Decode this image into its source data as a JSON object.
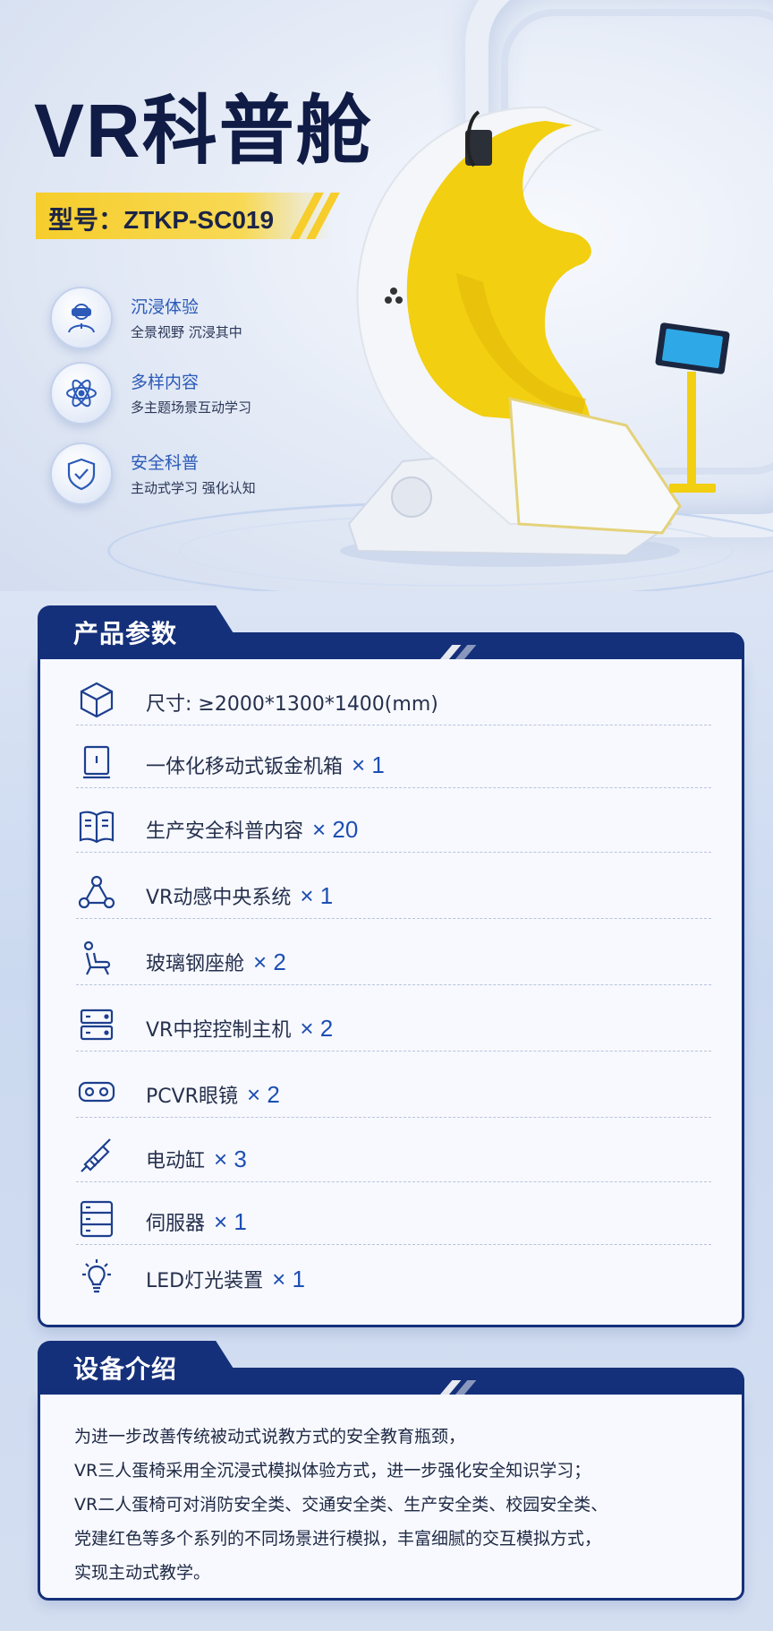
{
  "hero": {
    "title": "VR科普舱",
    "model": "型号：ZTKP-SC019",
    "features": [
      {
        "title": "沉浸体验",
        "subtitle": "全景视野 沉浸其中",
        "icon": "vr-headset-person-icon"
      },
      {
        "title": "多样内容",
        "subtitle": "多主题场景互动学习",
        "icon": "atom-icon"
      },
      {
        "title": "安全科普",
        "subtitle": "主动式学习 强化认知",
        "icon": "shield-check-icon"
      }
    ]
  },
  "specs": {
    "heading": "产品参数",
    "items": [
      {
        "label": "尺寸: ≥2000*1300*1400(mm)",
        "qty": "",
        "icon": "cube-icon"
      },
      {
        "label": "一体化移动式钣金机箱",
        "qty": "× 1",
        "icon": "cabinet-icon"
      },
      {
        "label": "生产安全科普内容",
        "qty": "× 20",
        "icon": "book-icon"
      },
      {
        "label": "VR动感中央系统",
        "qty": "× 1",
        "icon": "network-nodes-icon"
      },
      {
        "label": "玻璃钢座舱",
        "qty": "× 2",
        "icon": "seat-icon"
      },
      {
        "label": "VR中控控制主机",
        "qty": "× 2",
        "icon": "server-icon"
      },
      {
        "label": "PCVR眼镜",
        "qty": "× 2",
        "icon": "vr-goggles-icon"
      },
      {
        "label": "电动缸",
        "qty": "× 3",
        "icon": "cylinder-icon"
      },
      {
        "label": "伺服器",
        "qty": "× 1",
        "icon": "servo-rack-icon"
      },
      {
        "label": "LED灯光装置",
        "qty": "× 1",
        "icon": "light-bulb-icon"
      }
    ]
  },
  "intro": {
    "heading": "设备介绍",
    "lines": [
      "为进一步改善传统被动式说教方式的安全教育瓶颈，",
      "VR三人蛋椅采用全沉浸式模拟体验方式，进一步强化安全知识学习；",
      "VR二人蛋椅可对消防安全类、交通安全类、生产安全类、校园安全类、",
      "党建红色等多个系列的不同场景进行模拟，丰富细腻的交互模拟方式，",
      "实现主动式教学。"
    ]
  },
  "colors": {
    "navy": "#15307a",
    "accent_blue": "#1d4fb3",
    "gold": "#f6cd2b",
    "chair_yellow": "#f2cf10"
  }
}
